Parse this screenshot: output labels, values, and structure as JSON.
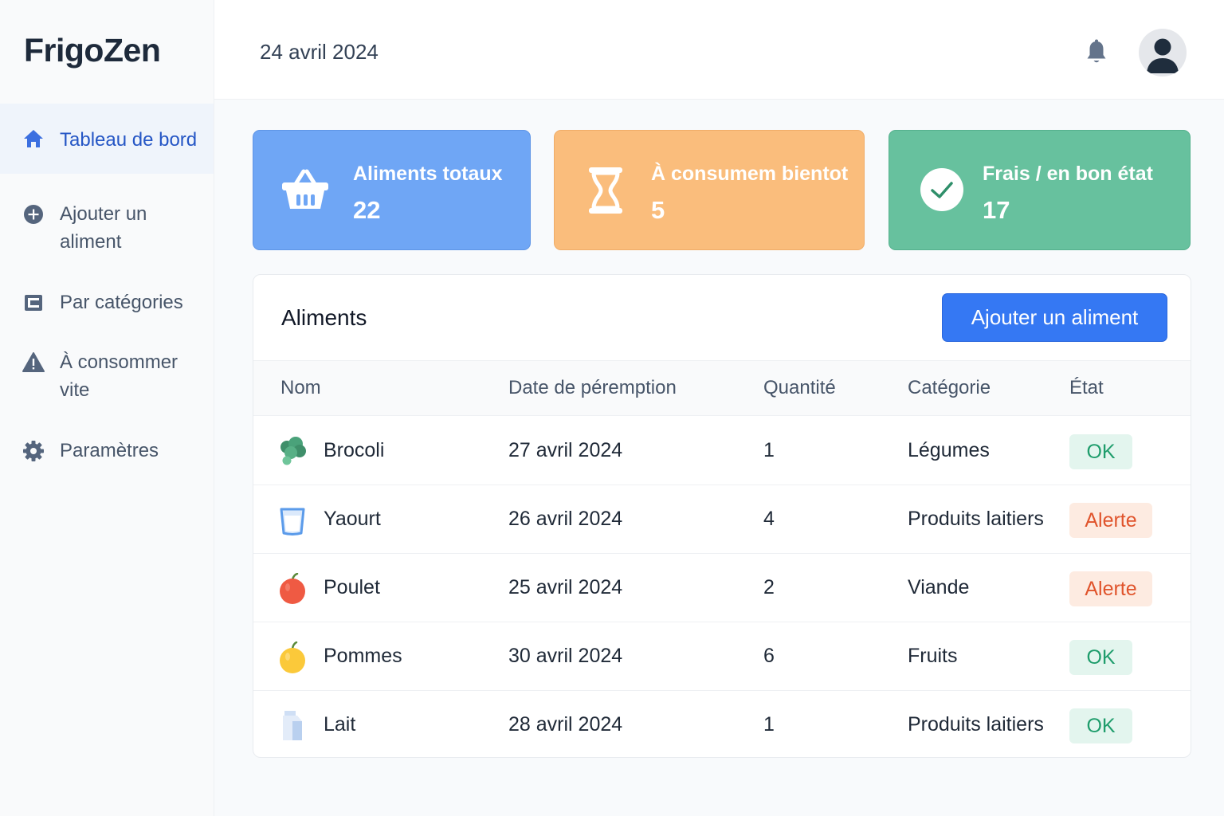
{
  "app": {
    "name": "FrigoZen"
  },
  "sidebar": {
    "items": [
      {
        "label": "Tableau de bord",
        "icon": "home-icon",
        "active": true
      },
      {
        "label": "Ajouter un aliment",
        "icon": "plus-circle-icon",
        "active": false
      },
      {
        "label": "Par catégories",
        "icon": "category-icon",
        "active": false
      },
      {
        "label": "À consommer vite",
        "icon": "warning-icon",
        "active": false
      },
      {
        "label": "Paramètres",
        "icon": "gear-icon",
        "active": false
      }
    ]
  },
  "header": {
    "date": "24 avril 2024",
    "bell_icon": "bell-icon",
    "avatar_icon": "user-avatar-icon"
  },
  "stats": [
    {
      "title": "Aliments totaux",
      "value": "22",
      "icon": "basket-icon",
      "color": "#6fa6f5"
    },
    {
      "title": "À consumem bientot",
      "value": "5",
      "icon": "hourglass-icon",
      "color": "#fabd7c"
    },
    {
      "title": "Frais / en bon état",
      "value": "17",
      "icon": "check-circle-icon",
      "color": "#67c19e"
    }
  ],
  "foods": {
    "title": "Aliments",
    "add_button": "Ajouter un aliment",
    "columns": [
      "Nom",
      "Date de péremption",
      "Quantité",
      "Catégorie",
      "État"
    ],
    "rows": [
      {
        "name": "Brocoli",
        "date": "27 avril 2024",
        "qty": "1",
        "category": "Légumes",
        "status": "OK",
        "status_type": "ok",
        "icon": "broccoli-icon"
      },
      {
        "name": "Yaourt",
        "date": "26 avril 2024",
        "qty": "4",
        "category": "Produits laitiers",
        "status": "Alerte",
        "status_type": "alert",
        "icon": "yogurt-icon"
      },
      {
        "name": "Poulet",
        "date": "25 avril 2024",
        "qty": "2",
        "category": "Viande",
        "status": "Alerte",
        "status_type": "alert",
        "icon": "red-apple-icon"
      },
      {
        "name": "Pommes",
        "date": "30 avril 2024",
        "qty": "6",
        "category": "Fruits",
        "status": "OK",
        "status_type": "ok",
        "icon": "yellow-apple-icon"
      },
      {
        "name": "Lait",
        "date": "28 avril 2024",
        "qty": "1",
        "category": "Produits laitiers",
        "status": "OK",
        "status_type": "ok",
        "icon": "milk-carton-icon"
      }
    ]
  },
  "colors": {
    "accent": "#3578f3",
    "ok": "#1f9d6c",
    "alert": "#e0542c"
  }
}
